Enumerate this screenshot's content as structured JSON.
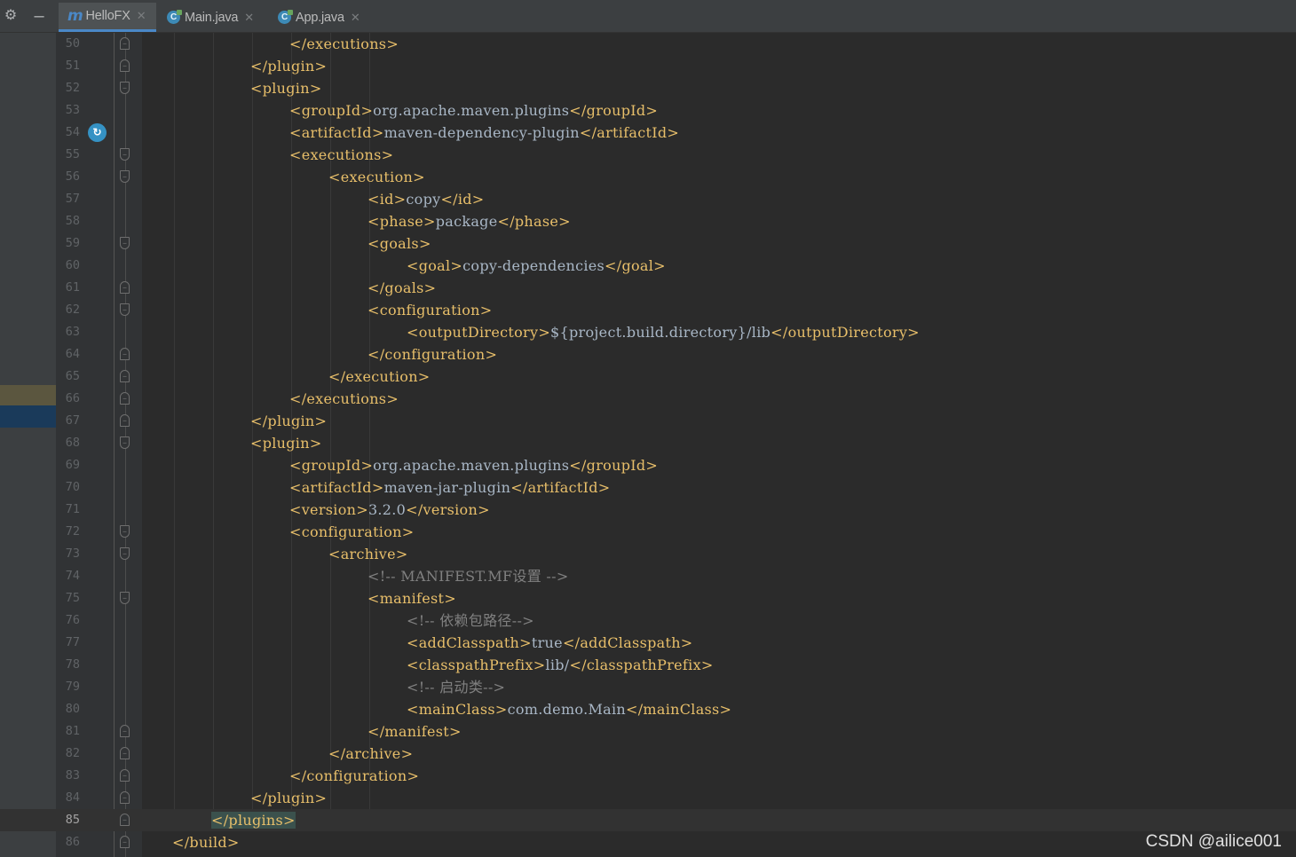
{
  "tabs": [
    {
      "label": "HelloFX",
      "icon": "maven-icon",
      "active": true
    },
    {
      "label": "Main.java",
      "icon": "java-class-icon",
      "active": false
    },
    {
      "label": "App.java",
      "icon": "java-class-icon",
      "active": false
    }
  ],
  "current_line": 85,
  "lines": [
    {
      "n": "50",
      "indent": 3,
      "parts": [
        [
          "tag",
          "</executions>"
        ]
      ],
      "fold": "close"
    },
    {
      "n": "51",
      "indent": 2,
      "parts": [
        [
          "tag",
          "</plugin>"
        ]
      ],
      "fold": "close"
    },
    {
      "n": "52",
      "indent": 2,
      "parts": [
        [
          "tag",
          "<plugin>"
        ]
      ],
      "fold": "open"
    },
    {
      "n": "53",
      "indent": 3,
      "parts": [
        [
          "tag",
          "<groupId>"
        ],
        [
          "txt",
          "org.apache.maven.plugins"
        ],
        [
          "tag",
          "</groupId>"
        ]
      ],
      "fold": ""
    },
    {
      "n": "54",
      "indent": 3,
      "parts": [
        [
          "tag",
          "<artifactId>"
        ],
        [
          "txt",
          "maven-dependency-plugin"
        ],
        [
          "tag",
          "</artifactId>"
        ]
      ],
      "fold": "",
      "gutter_icon": "override-method-icon"
    },
    {
      "n": "55",
      "indent": 3,
      "parts": [
        [
          "tag",
          "<executions>"
        ]
      ],
      "fold": "open"
    },
    {
      "n": "56",
      "indent": 4,
      "parts": [
        [
          "tag",
          "<execution>"
        ]
      ],
      "fold": "open"
    },
    {
      "n": "57",
      "indent": 5,
      "parts": [
        [
          "tag",
          "<id>"
        ],
        [
          "txt",
          "copy"
        ],
        [
          "tag",
          "</id>"
        ]
      ],
      "fold": ""
    },
    {
      "n": "58",
      "indent": 5,
      "parts": [
        [
          "tag",
          "<phase>"
        ],
        [
          "txt",
          "package"
        ],
        [
          "tag",
          "</phase>"
        ]
      ],
      "fold": ""
    },
    {
      "n": "59",
      "indent": 5,
      "parts": [
        [
          "tag",
          "<goals>"
        ]
      ],
      "fold": "open"
    },
    {
      "n": "60",
      "indent": 6,
      "parts": [
        [
          "tag",
          "<goal>"
        ],
        [
          "txt",
          "copy-dependencies"
        ],
        [
          "tag",
          "</goal>"
        ]
      ],
      "fold": ""
    },
    {
      "n": "61",
      "indent": 5,
      "parts": [
        [
          "tag",
          "</goals>"
        ]
      ],
      "fold": "close"
    },
    {
      "n": "62",
      "indent": 5,
      "parts": [
        [
          "tag",
          "<configuration>"
        ]
      ],
      "fold": "open"
    },
    {
      "n": "63",
      "indent": 6,
      "parts": [
        [
          "tag",
          "<outputDirectory>"
        ],
        [
          "txt",
          "${project.build.directory}/lib"
        ],
        [
          "tag",
          "</outputDirectory>"
        ]
      ],
      "fold": ""
    },
    {
      "n": "64",
      "indent": 5,
      "parts": [
        [
          "tag",
          "</configuration>"
        ]
      ],
      "fold": "close"
    },
    {
      "n": "65",
      "indent": 4,
      "parts": [
        [
          "tag",
          "</execution>"
        ]
      ],
      "fold": "close"
    },
    {
      "n": "66",
      "indent": 3,
      "parts": [
        [
          "tag",
          "</executions>"
        ]
      ],
      "fold": "close"
    },
    {
      "n": "67",
      "indent": 2,
      "parts": [
        [
          "tag",
          "</plugin>"
        ]
      ],
      "fold": "close"
    },
    {
      "n": "68",
      "indent": 2,
      "parts": [
        [
          "tag",
          "<plugin>"
        ]
      ],
      "fold": "open"
    },
    {
      "n": "69",
      "indent": 3,
      "parts": [
        [
          "tag",
          "<groupId>"
        ],
        [
          "txt",
          "org.apache.maven.plugins"
        ],
        [
          "tag",
          "</groupId>"
        ]
      ],
      "fold": ""
    },
    {
      "n": "70",
      "indent": 3,
      "parts": [
        [
          "tag",
          "<artifactId>"
        ],
        [
          "txt",
          "maven-jar-plugin"
        ],
        [
          "tag",
          "</artifactId>"
        ]
      ],
      "fold": ""
    },
    {
      "n": "71",
      "indent": 3,
      "parts": [
        [
          "tag",
          "<version>"
        ],
        [
          "txt",
          "3.2.0"
        ],
        [
          "tag",
          "</version>"
        ]
      ],
      "fold": ""
    },
    {
      "n": "72",
      "indent": 3,
      "parts": [
        [
          "tag",
          "<configuration>"
        ]
      ],
      "fold": "open"
    },
    {
      "n": "73",
      "indent": 4,
      "parts": [
        [
          "tag",
          "<archive>"
        ]
      ],
      "fold": "open"
    },
    {
      "n": "74",
      "indent": 5,
      "parts": [
        [
          "cmt",
          "<!-- MANIFEST.MF设置 -->"
        ]
      ],
      "fold": ""
    },
    {
      "n": "75",
      "indent": 5,
      "parts": [
        [
          "tag",
          "<manifest>"
        ]
      ],
      "fold": "open"
    },
    {
      "n": "76",
      "indent": 6,
      "parts": [
        [
          "cmt",
          "<!-- 依赖包路径-->"
        ]
      ],
      "fold": ""
    },
    {
      "n": "77",
      "indent": 6,
      "parts": [
        [
          "tag",
          "<addClasspath>"
        ],
        [
          "txt",
          "true"
        ],
        [
          "tag",
          "</addClasspath>"
        ]
      ],
      "fold": ""
    },
    {
      "n": "78",
      "indent": 6,
      "parts": [
        [
          "tag",
          "<classpathPrefix>"
        ],
        [
          "txt",
          "lib/"
        ],
        [
          "tag",
          "</classpathPrefix>"
        ]
      ],
      "fold": ""
    },
    {
      "n": "79",
      "indent": 6,
      "parts": [
        [
          "cmt",
          "<!-- 启动类-->"
        ]
      ],
      "fold": ""
    },
    {
      "n": "80",
      "indent": 6,
      "parts": [
        [
          "tag",
          "<mainClass>"
        ],
        [
          "txt",
          "com.demo.Main"
        ],
        [
          "tag",
          "</mainClass>"
        ]
      ],
      "fold": ""
    },
    {
      "n": "81",
      "indent": 5,
      "parts": [
        [
          "tag",
          "</manifest>"
        ]
      ],
      "fold": "close"
    },
    {
      "n": "82",
      "indent": 4,
      "parts": [
        [
          "tag",
          "</archive>"
        ]
      ],
      "fold": "close"
    },
    {
      "n": "83",
      "indent": 3,
      "parts": [
        [
          "tag",
          "</configuration>"
        ]
      ],
      "fold": "close"
    },
    {
      "n": "84",
      "indent": 2,
      "parts": [
        [
          "tag",
          "</plugin>"
        ]
      ],
      "fold": "close"
    },
    {
      "n": "85",
      "indent": 1,
      "parts": [
        [
          "hl",
          "</plugins>"
        ]
      ],
      "fold": "close"
    },
    {
      "n": "86",
      "indent": 0,
      "parts": [
        [
          "tag",
          "</build>"
        ]
      ],
      "fold": "close"
    }
  ],
  "watermark": "CSDN @ailice001",
  "colors": {
    "tag": "#e8bf6a",
    "text": "#a9b7c6",
    "comment": "#808080",
    "background": "#2b2b2b"
  }
}
